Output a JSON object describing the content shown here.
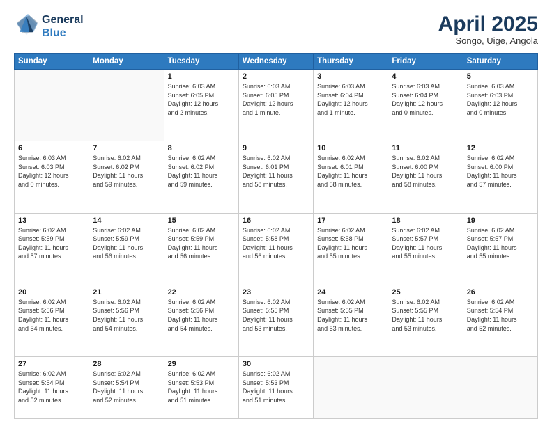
{
  "header": {
    "logo_line1": "General",
    "logo_line2": "Blue",
    "month_year": "April 2025",
    "location": "Songo, Uige, Angola"
  },
  "weekdays": [
    "Sunday",
    "Monday",
    "Tuesday",
    "Wednesday",
    "Thursday",
    "Friday",
    "Saturday"
  ],
  "weeks": [
    [
      {
        "day": "",
        "info": ""
      },
      {
        "day": "",
        "info": ""
      },
      {
        "day": "1",
        "info": "Sunrise: 6:03 AM\nSunset: 6:05 PM\nDaylight: 12 hours\nand 2 minutes."
      },
      {
        "day": "2",
        "info": "Sunrise: 6:03 AM\nSunset: 6:05 PM\nDaylight: 12 hours\nand 1 minute."
      },
      {
        "day": "3",
        "info": "Sunrise: 6:03 AM\nSunset: 6:04 PM\nDaylight: 12 hours\nand 1 minute."
      },
      {
        "day": "4",
        "info": "Sunrise: 6:03 AM\nSunset: 6:04 PM\nDaylight: 12 hours\nand 0 minutes."
      },
      {
        "day": "5",
        "info": "Sunrise: 6:03 AM\nSunset: 6:03 PM\nDaylight: 12 hours\nand 0 minutes."
      }
    ],
    [
      {
        "day": "6",
        "info": "Sunrise: 6:03 AM\nSunset: 6:03 PM\nDaylight: 12 hours\nand 0 minutes."
      },
      {
        "day": "7",
        "info": "Sunrise: 6:02 AM\nSunset: 6:02 PM\nDaylight: 11 hours\nand 59 minutes."
      },
      {
        "day": "8",
        "info": "Sunrise: 6:02 AM\nSunset: 6:02 PM\nDaylight: 11 hours\nand 59 minutes."
      },
      {
        "day": "9",
        "info": "Sunrise: 6:02 AM\nSunset: 6:01 PM\nDaylight: 11 hours\nand 58 minutes."
      },
      {
        "day": "10",
        "info": "Sunrise: 6:02 AM\nSunset: 6:01 PM\nDaylight: 11 hours\nand 58 minutes."
      },
      {
        "day": "11",
        "info": "Sunrise: 6:02 AM\nSunset: 6:00 PM\nDaylight: 11 hours\nand 58 minutes."
      },
      {
        "day": "12",
        "info": "Sunrise: 6:02 AM\nSunset: 6:00 PM\nDaylight: 11 hours\nand 57 minutes."
      }
    ],
    [
      {
        "day": "13",
        "info": "Sunrise: 6:02 AM\nSunset: 5:59 PM\nDaylight: 11 hours\nand 57 minutes."
      },
      {
        "day": "14",
        "info": "Sunrise: 6:02 AM\nSunset: 5:59 PM\nDaylight: 11 hours\nand 56 minutes."
      },
      {
        "day": "15",
        "info": "Sunrise: 6:02 AM\nSunset: 5:59 PM\nDaylight: 11 hours\nand 56 minutes."
      },
      {
        "day": "16",
        "info": "Sunrise: 6:02 AM\nSunset: 5:58 PM\nDaylight: 11 hours\nand 56 minutes."
      },
      {
        "day": "17",
        "info": "Sunrise: 6:02 AM\nSunset: 5:58 PM\nDaylight: 11 hours\nand 55 minutes."
      },
      {
        "day": "18",
        "info": "Sunrise: 6:02 AM\nSunset: 5:57 PM\nDaylight: 11 hours\nand 55 minutes."
      },
      {
        "day": "19",
        "info": "Sunrise: 6:02 AM\nSunset: 5:57 PM\nDaylight: 11 hours\nand 55 minutes."
      }
    ],
    [
      {
        "day": "20",
        "info": "Sunrise: 6:02 AM\nSunset: 5:56 PM\nDaylight: 11 hours\nand 54 minutes."
      },
      {
        "day": "21",
        "info": "Sunrise: 6:02 AM\nSunset: 5:56 PM\nDaylight: 11 hours\nand 54 minutes."
      },
      {
        "day": "22",
        "info": "Sunrise: 6:02 AM\nSunset: 5:56 PM\nDaylight: 11 hours\nand 54 minutes."
      },
      {
        "day": "23",
        "info": "Sunrise: 6:02 AM\nSunset: 5:55 PM\nDaylight: 11 hours\nand 53 minutes."
      },
      {
        "day": "24",
        "info": "Sunrise: 6:02 AM\nSunset: 5:55 PM\nDaylight: 11 hours\nand 53 minutes."
      },
      {
        "day": "25",
        "info": "Sunrise: 6:02 AM\nSunset: 5:55 PM\nDaylight: 11 hours\nand 53 minutes."
      },
      {
        "day": "26",
        "info": "Sunrise: 6:02 AM\nSunset: 5:54 PM\nDaylight: 11 hours\nand 52 minutes."
      }
    ],
    [
      {
        "day": "27",
        "info": "Sunrise: 6:02 AM\nSunset: 5:54 PM\nDaylight: 11 hours\nand 52 minutes."
      },
      {
        "day": "28",
        "info": "Sunrise: 6:02 AM\nSunset: 5:54 PM\nDaylight: 11 hours\nand 52 minutes."
      },
      {
        "day": "29",
        "info": "Sunrise: 6:02 AM\nSunset: 5:53 PM\nDaylight: 11 hours\nand 51 minutes."
      },
      {
        "day": "30",
        "info": "Sunrise: 6:02 AM\nSunset: 5:53 PM\nDaylight: 11 hours\nand 51 minutes."
      },
      {
        "day": "",
        "info": ""
      },
      {
        "day": "",
        "info": ""
      },
      {
        "day": "",
        "info": ""
      }
    ]
  ]
}
